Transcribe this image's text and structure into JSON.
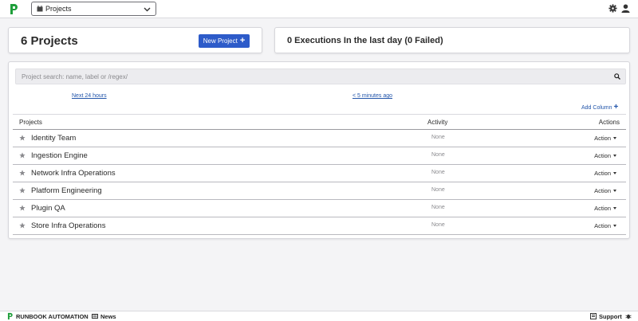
{
  "topbar": {
    "project_selector_label": "Projects",
    "brand_color": "#1e9e3a"
  },
  "summary": {
    "projects_count_text": "6 Projects",
    "new_project_label": "New Project",
    "executions_text": "0 Executions In the last day (0 Failed)",
    "accent_color": "#2d5bc9"
  },
  "search": {
    "placeholder": "Project search: name, label or /regex/",
    "value": ""
  },
  "links": {
    "next": "Next 24 hours",
    "ago": "< 5 minutes ago",
    "add_column": "Add Column"
  },
  "table": {
    "headers": {
      "projects": "Projects",
      "activity": "Activity",
      "actions": "Actions"
    },
    "rows": [
      {
        "name": "Identity Team",
        "activity": "None",
        "action": "Action"
      },
      {
        "name": "Ingestion Engine",
        "activity": "None",
        "action": "Action"
      },
      {
        "name": "Network Infra Operations",
        "activity": "None",
        "action": "Action"
      },
      {
        "name": "Platform Engineering",
        "activity": "None",
        "action": "Action"
      },
      {
        "name": "Plugin QA",
        "activity": "None",
        "action": "Action"
      },
      {
        "name": "Store Infra Operations",
        "activity": "None",
        "action": "Action"
      }
    ]
  },
  "footer": {
    "brand": "RUNBOOK AUTOMATION",
    "news": "News",
    "support": "Support"
  },
  "icons": [
    "logo-icon",
    "calendar-icon",
    "chevron-down-icon",
    "gear-icon",
    "user-icon",
    "search-icon",
    "plus-icon",
    "star-icon",
    "caret-down-icon",
    "news-icon",
    "support-icon",
    "bug-icon"
  ]
}
